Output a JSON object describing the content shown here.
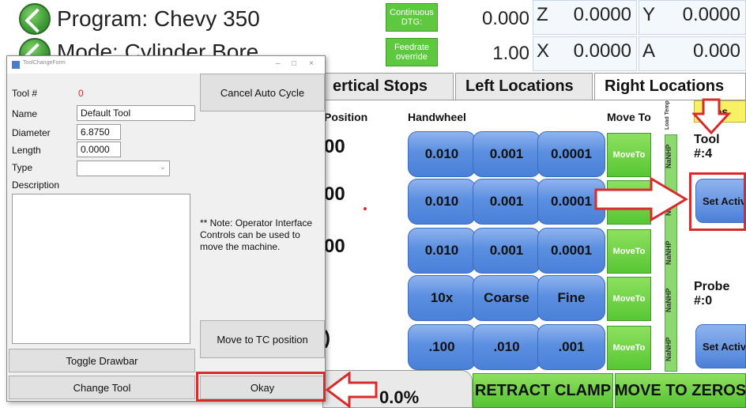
{
  "header": {
    "program_label": "Program: Chevy 350",
    "mode_label": "Mode: Cylinder Bore",
    "continuous_dtg_label": "Continuous DTG:",
    "continuous_dtg_value": "0.000",
    "feedrate_label": "Feedrate override",
    "feedrate_value": "1.00",
    "axes": [
      {
        "axis": "Z",
        "value": "0.0000"
      },
      {
        "axis": "Y",
        "value": "0.0000"
      },
      {
        "axis": "X",
        "value": "0.0000"
      },
      {
        "axis": "A",
        "value": "0.000"
      }
    ]
  },
  "tabs": [
    {
      "label": "ertical Stops"
    },
    {
      "label": "Left Locations"
    },
    {
      "label": "Right Locations"
    }
  ],
  "main": {
    "position_header": "Position",
    "handwheel_header": "Handwheel",
    "moveto_header": "Move To",
    "load_temp_header": "Load Temp",
    "notes_label": "tes",
    "positions": [
      "00",
      "00",
      "00",
      ")"
    ],
    "handwheel_rows": [
      [
        "0.010",
        "0.001",
        "0.0001"
      ],
      [
        "0.010",
        "0.001",
        "0.0001"
      ],
      [
        "0.010",
        "0.001",
        "0.0001"
      ],
      [
        "10x",
        "Coarse",
        "Fine"
      ],
      [
        ".100",
        ".010",
        ".001"
      ]
    ],
    "moveto_labels": [
      "MoveTo",
      "Move",
      "MoveTo",
      "MoveTo",
      "MoveTo"
    ],
    "nanhp_labels": [
      "NaNHP",
      "NaNHP",
      "NaNHP",
      "NaNHP",
      "NaNHP"
    ],
    "tool_label": "Tool #:4",
    "probe_label": "Probe #:0",
    "set_active_label": "Set Active",
    "set_active_label_2": "Set Activ",
    "percent": "0.0%",
    "retract_clamp": "RETRACT CLAMP",
    "move_to_zeros": "MOVE TO ZEROS"
  },
  "dialog": {
    "title": "ToolChangeForm",
    "tool_num_label": "Tool #",
    "tool_num_value": "0",
    "name_label": "Name",
    "name_value": "Default Tool",
    "diameter_label": "Diameter",
    "diameter_value": "6.8750",
    "length_label": "Length",
    "length_value": "0.0000",
    "type_label": "Type",
    "description_label": "Description",
    "cancel_auto_cycle": "Cancel Auto Cycle",
    "note": "** Note: Operator Interface Controls can be used to move the machine.",
    "move_to_tc": "Move to TC position",
    "toggle_drawbar": "Toggle Drawbar",
    "change_tool": "Change Tool",
    "okay": "Okay"
  },
  "colors": {
    "accent_red": "#d92b2b",
    "button_blue": "#5b8fe0",
    "button_green": "#57c734",
    "notes_yellow": "#f8f065"
  }
}
